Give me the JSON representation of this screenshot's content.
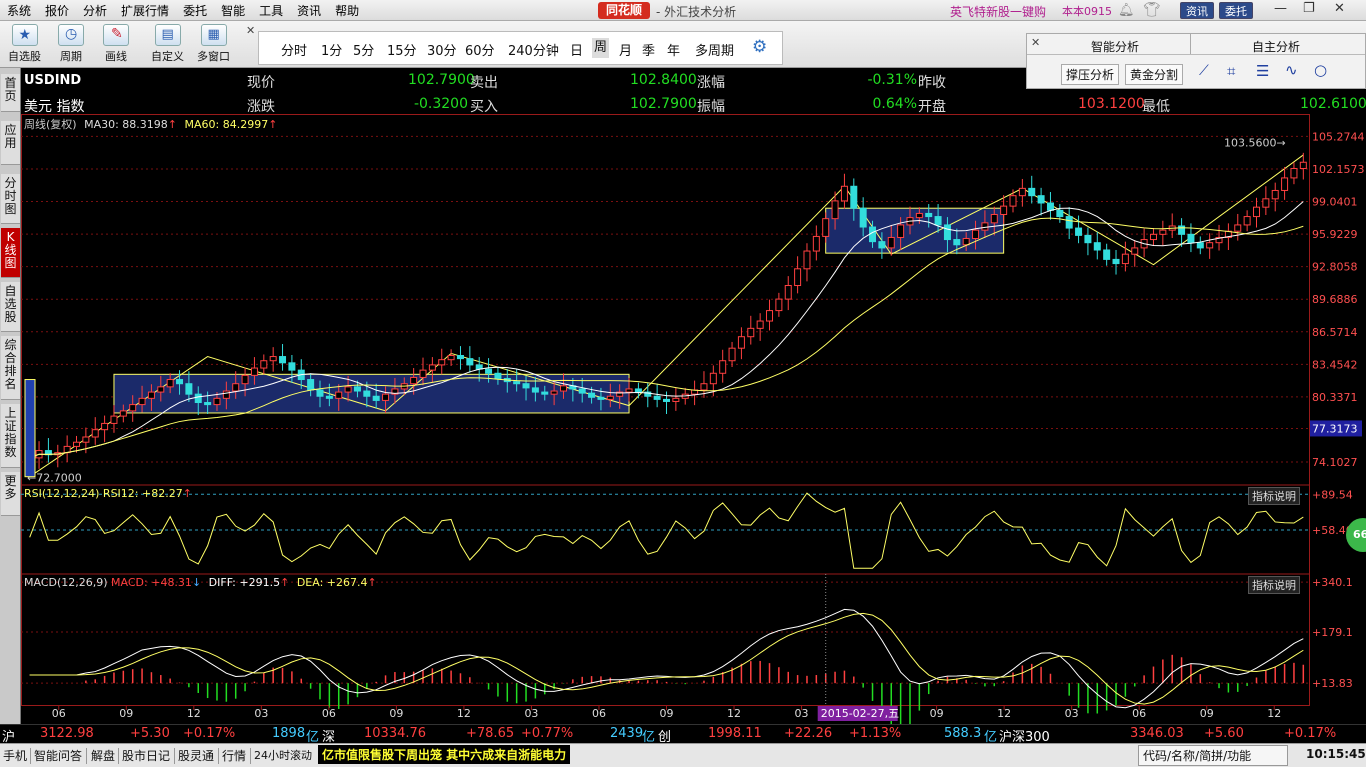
{
  "menu": [
    "系统",
    "报价",
    "分析",
    "扩展行情",
    "委托",
    "智能",
    "工具",
    "资讯",
    "帮助"
  ],
  "app": {
    "logo": "同花顺",
    "title": "- 外汇技术分析",
    "promo": "英飞特新股一键购",
    "version": "本本0915",
    "btn_info": "资讯",
    "btn_trade": "委托"
  },
  "tools": {
    "watchlist": "自选股",
    "period": "周期",
    "draw": "画线",
    "custom": "自定义",
    "multiwin": "多窗口"
  },
  "periods": [
    "分时",
    "1分",
    "5分",
    "15分",
    "30分",
    "60分",
    "240分钟",
    "日",
    "周",
    "月",
    "季",
    "年",
    "多周期"
  ],
  "active_period": "周",
  "smart": {
    "tab1": "智能分析",
    "tab2": "自主分析",
    "btn_support": "撑压分析",
    "btn_gold": "黄金分割"
  },
  "sidebar": [
    "首页",
    "应用",
    "分时图",
    "K线图",
    "自选股",
    "综合排名",
    "上证指数",
    "更多"
  ],
  "quote": {
    "code": "USDIND",
    "name": "美元 指数",
    "l_price": "现价",
    "price": "102.7900",
    "l_sell": "卖出",
    "sell": "102.8400",
    "l_pct": "涨幅",
    "pct": "-0.31%",
    "l_prev": "昨收",
    "l_chg": "涨跌",
    "chg": "-0.3200",
    "l_buy": "买入",
    "buy": "102.7900",
    "l_amp": "振幅",
    "amp": "0.64%",
    "l_open": "开盘",
    "open": "103.1200",
    "l_low": "最低",
    "low": "102.6100"
  },
  "kline": {
    "header": "周线(复权)",
    "ma30_label": "MA30: 88.3198",
    "ma60_label": "MA60: 84.2997",
    "yticks": [
      "105.2744",
      "102.1573",
      "99.0401",
      "95.9229",
      "92.8058",
      "89.6886",
      "86.5714",
      "83.4542",
      "80.3371",
      "77.3173",
      "74.1027"
    ],
    "ylim": [
      72.0,
      105.6
    ],
    "high_label": "103.5600",
    "low_label": "72.7000",
    "cursor_label": "77.3173",
    "closes": [
      74.5,
      75.2,
      74.8,
      75.0,
      75.6,
      76.0,
      76.5,
      77.2,
      77.8,
      78.5,
      79.0,
      79.6,
      80.2,
      80.8,
      81.3,
      82.0,
      81.6,
      80.6,
      79.8,
      79.6,
      80.2,
      80.9,
      81.6,
      82.4,
      83.1,
      83.8,
      84.2,
      83.6,
      82.9,
      82.0,
      81.0,
      80.4,
      80.2,
      80.8,
      81.3,
      80.9,
      80.4,
      80.0,
      80.6,
      81.1,
      81.6,
      82.2,
      82.9,
      83.4,
      83.9,
      84.3,
      84.0,
      83.4,
      83.0,
      82.6,
      82.1,
      81.8,
      81.6,
      81.2,
      80.8,
      80.6,
      80.9,
      81.4,
      81.1,
      80.7,
      80.3,
      80.1,
      80.4,
      80.8,
      81.1,
      80.8,
      80.4,
      80.1,
      79.9,
      80.2,
      80.6,
      81.0,
      81.6,
      82.6,
      83.8,
      85.0,
      86.1,
      86.9,
      87.6,
      88.6,
      89.7,
      91.0,
      92.6,
      94.3,
      95.7,
      97.4,
      99.1,
      100.5,
      98.4,
      96.6,
      95.2,
      94.6,
      95.6,
      96.8,
      97.5,
      97.9,
      97.6,
      96.8,
      95.4,
      94.9,
      95.5,
      96.3,
      97.0,
      97.8,
      98.6,
      99.6,
      100.3,
      99.6,
      98.9,
      98.2,
      97.6,
      96.5,
      95.8,
      95.1,
      94.4,
      93.5,
      93.1,
      94.0,
      94.6,
      95.4,
      95.9,
      96.3,
      96.7,
      95.9,
      95.1,
      94.6,
      95.1,
      95.6,
      96.2,
      96.8,
      97.6,
      98.5,
      99.3,
      100.1,
      101.3,
      102.2,
      102.8
    ],
    "boxes": [
      {
        "x1": "2012-06",
        "x2": "2014-05",
        "top": 82.5,
        "bottom": 78.8
      },
      {
        "x1": "2015-02",
        "x2": "2015-10",
        "top": 98.4,
        "bottom": 94.1
      }
    ]
  },
  "rsi": {
    "label": "RSI(12,12,24) RSI12: +82.27",
    "btn": "指标说明",
    "yticks": [
      "+89.54",
      "+58.40"
    ]
  },
  "macd": {
    "label_pre": "MACD(12,26,9)",
    "macd": "MACD: +48.31",
    "diff": "DIFF: +291.5",
    "dea": "DEA: +267.4",
    "btn": "指标说明",
    "yticks": [
      "+340.1",
      "+179.1",
      "+13.83"
    ]
  },
  "xaxis": {
    "ticks": [
      "06",
      "09",
      "12",
      "03",
      "06",
      "09",
      "12",
      "03",
      "06",
      "09",
      "12",
      "03",
      "06",
      "09",
      "12",
      "03",
      "06",
      "09",
      "12"
    ],
    "cursor_date": "2015-02-27,五"
  },
  "badge": "66",
  "status": {
    "sh": "沪",
    "sh_idx": "3122.98",
    "sh_chg": "+5.30",
    "sh_pct": "+0.17%",
    "sh_vol": "1898",
    "yi": "亿",
    "sz": "深",
    "sz_idx": "10334.76",
    "sz_chg": "+78.65",
    "sz_pct": "+0.77%",
    "sz_vol": "2439",
    "cy": "创",
    "cy_idx": "1998.11",
    "cy_chg": "+22.26",
    "cy_pct": "+1.13%",
    "cy_vol": "588.3",
    "hs": "沪深300",
    "hs_idx": "3346.03",
    "hs_chg": "+5.60",
    "hs_pct": "+0.17%"
  },
  "bottom": {
    "items": [
      "手机",
      "智能问答",
      "解盘",
      "股市日记",
      "股灵通",
      "行情",
      "24小时滚动"
    ],
    "news": "亿市值限售股下周出笼 其中六成来自浙能电力",
    "search": "代码/名称/简拼/功能",
    "time": "10:15:45"
  },
  "colors": {
    "up": "#ff4040",
    "down": "#22dd22",
    "ma": "#ffff66",
    "box": "#1b2a6a"
  }
}
